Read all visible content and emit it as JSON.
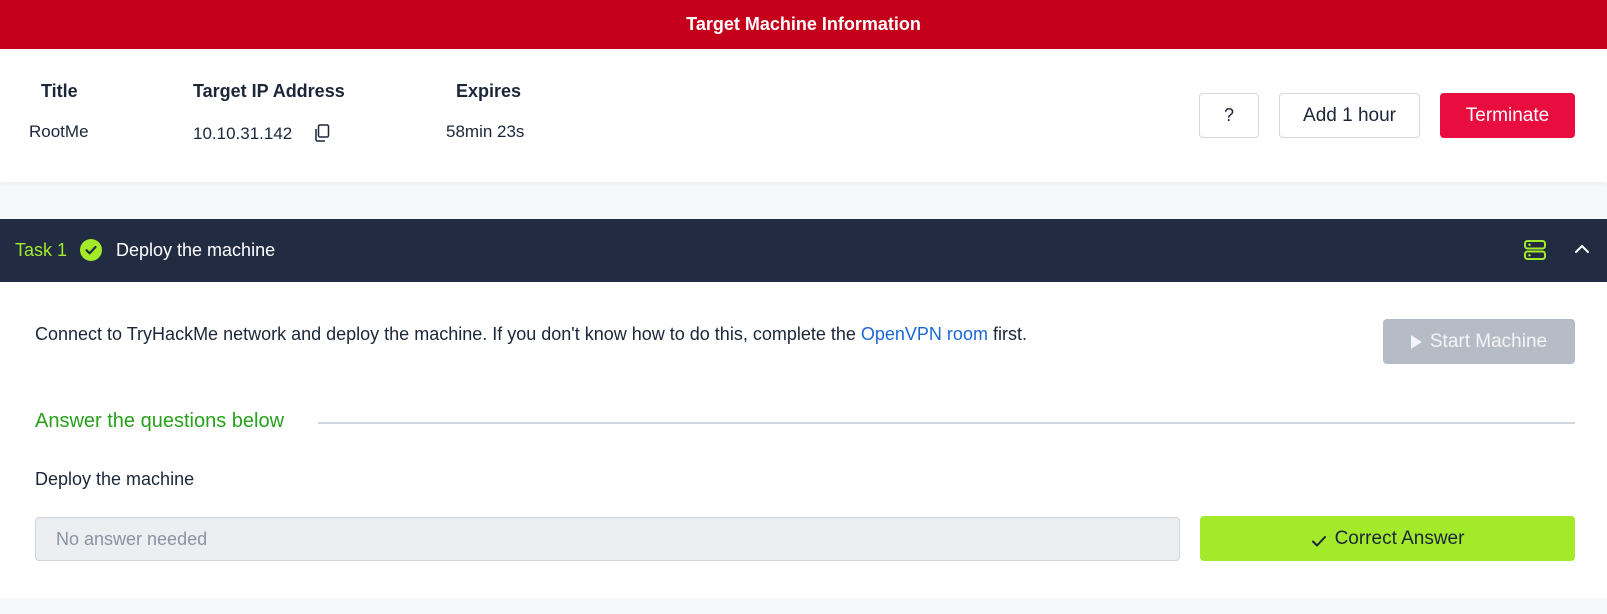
{
  "banner": {
    "title": "Target Machine Information"
  },
  "machine": {
    "title_header": "Title",
    "title_value": "RootMe",
    "ip_header": "Target IP Address",
    "ip_value": "10.10.31.142",
    "expires_header": "Expires",
    "expires_value": "58min 23s",
    "help_label": "?",
    "add_hour_label": "Add 1 hour",
    "terminate_label": "Terminate"
  },
  "task": {
    "number_label": "Task 1",
    "title": "Deploy the machine",
    "completed": true,
    "description_before": "Connect to TryHackMe network and deploy the machine. If you don't know how to do this, complete the ",
    "description_link": "OpenVPN room",
    "description_after": " first.",
    "start_machine_label": "Start Machine",
    "answer_section_title": "Answer the questions below",
    "question": "Deploy the machine",
    "answer_placeholder": "No answer needed",
    "correct_answer_label": "Correct Answer"
  },
  "colors": {
    "banner_red": "#c4001a",
    "terminate_red": "#e90c3f",
    "task_bar_navy": "#212c42",
    "accent_green": "#a3ea2a",
    "answer_heading_green": "#27a11c",
    "link_blue": "#1c67d4"
  },
  "icons": [
    "copy-icon",
    "check-circle-icon",
    "server-icon",
    "chevron-up-icon",
    "play-icon",
    "checkmark-icon"
  ]
}
